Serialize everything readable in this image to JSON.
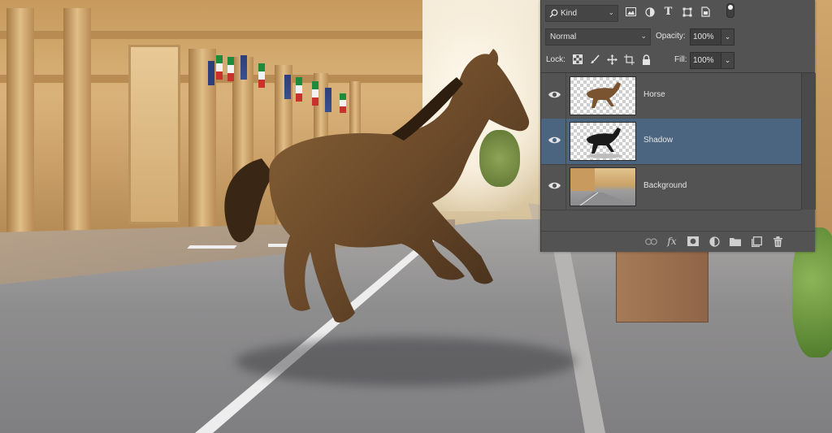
{
  "scene": {
    "horse_color": "#6b4a2a",
    "road_color": "#8f8e8f"
  },
  "panel": {
    "filter": {
      "kind_label": "Kind"
    },
    "blend": {
      "mode": "Normal",
      "opacity_label": "Opacity:",
      "opacity_value": "100%"
    },
    "lock": {
      "label": "Lock:",
      "fill_label": "Fill:",
      "fill_value": "100%"
    },
    "layers": [
      {
        "name": "Horse",
        "visible": true,
        "selected": false
      },
      {
        "name": "Shadow",
        "visible": true,
        "selected": true
      },
      {
        "name": "Background",
        "visible": true,
        "selected": false
      }
    ],
    "colors": {
      "panel_bg": "#535353",
      "selected_row": "#4b6581",
      "text": "#e3e3e3"
    }
  }
}
